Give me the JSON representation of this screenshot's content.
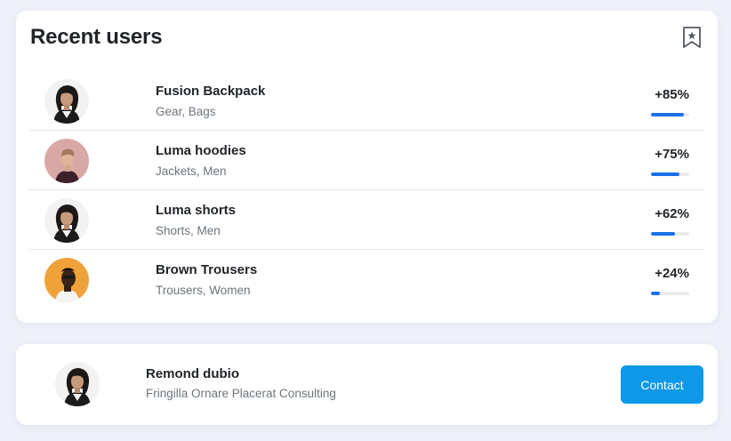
{
  "recent_users": {
    "title": "Recent users",
    "bookmark_icon": "bookmark-star-icon",
    "items": [
      {
        "name": "Fusion Backpack",
        "categories": "Gear, Bags",
        "percent_label": "+85%",
        "progress": 0.85,
        "avatar": "woman-curly-hair-avatar"
      },
      {
        "name": "Luma hoodies",
        "categories": "Jackets, Men",
        "percent_label": "+75%",
        "progress": 0.75,
        "avatar": "man-pink-background-avatar"
      },
      {
        "name": "Luma shorts",
        "categories": "Shorts, Men",
        "percent_label": "+62%",
        "progress": 0.62,
        "avatar": "woman-curly-hair-avatar"
      },
      {
        "name": "Brown Trousers",
        "categories": "Trousers, Women",
        "percent_label": "+24%",
        "progress": 0.24,
        "avatar": "man-orange-background-avatar"
      }
    ]
  },
  "profile": {
    "name": "Remond dubio",
    "company": "Fringilla Ornare Placerat Consulting",
    "avatar": "woman-curly-hair-avatar",
    "contact_label": "Contact"
  },
  "colors": {
    "background": "#eef1f9",
    "progress_fill": "#1a6fe8",
    "progress_track": "#e9ecef",
    "contact_button": "#0d99e8"
  }
}
